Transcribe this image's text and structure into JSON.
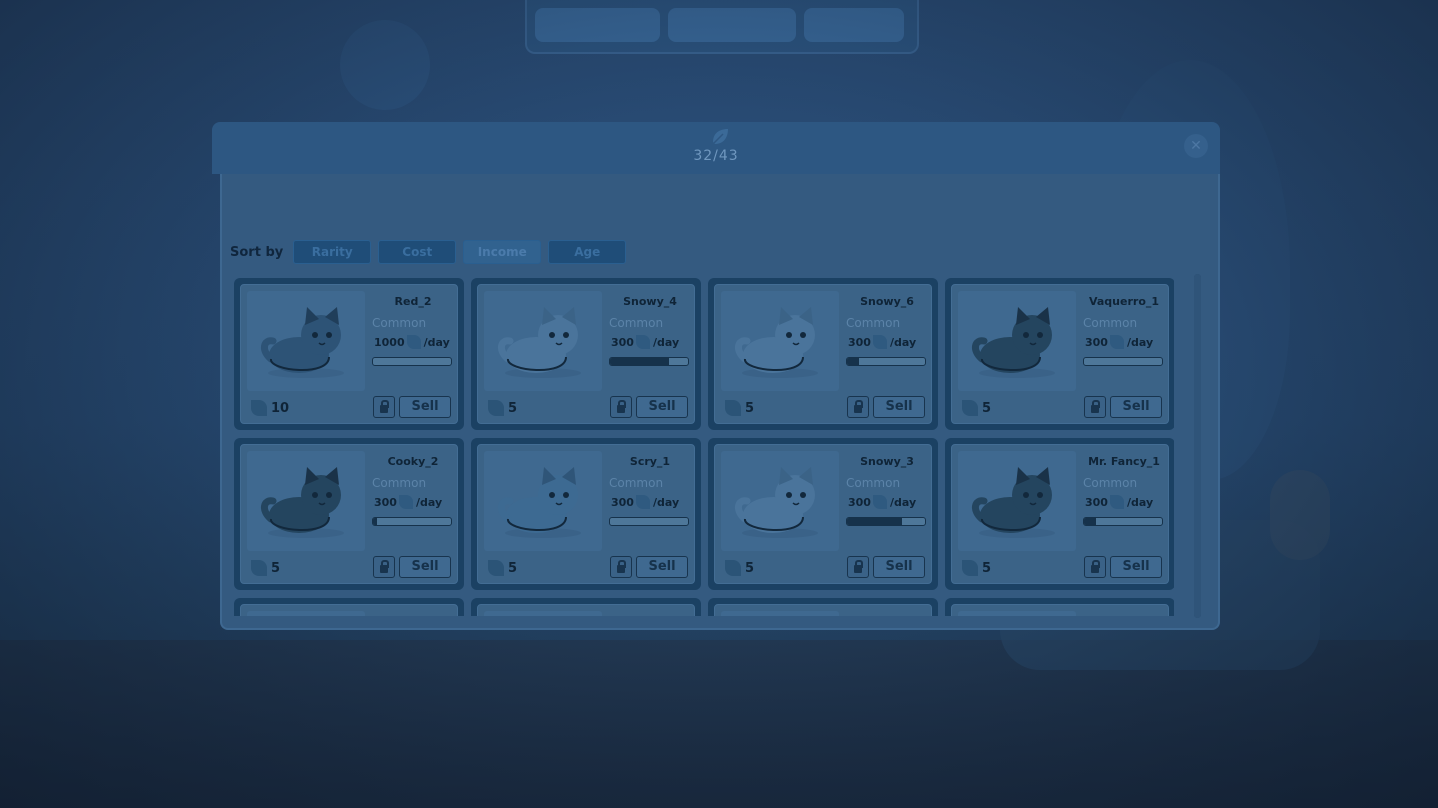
{
  "header": {
    "count": "32/43",
    "icon": "leaf-icon"
  },
  "sort": {
    "label": "Sort by",
    "options": [
      {
        "label": "Rarity",
        "active": false
      },
      {
        "label": "Cost",
        "active": false
      },
      {
        "label": "Income",
        "active": true
      },
      {
        "label": "Age",
        "active": false
      }
    ]
  },
  "pets": [
    {
      "name": "Red_2",
      "rarity": "Common",
      "rate": "1000",
      "unit": "/day",
      "cost": "10",
      "progress": 0.0,
      "fur": "red"
    },
    {
      "name": "Snowy_4",
      "rarity": "Common",
      "rate": "300",
      "unit": "/day",
      "cost": "5",
      "progress": 0.75,
      "fur": "white"
    },
    {
      "name": "Snowy_6",
      "rarity": "Common",
      "rate": "300",
      "unit": "/day",
      "cost": "5",
      "progress": 0.15,
      "fur": "white"
    },
    {
      "name": "Vaquerro_1",
      "rarity": "Common",
      "rate": "300",
      "unit": "/day",
      "cost": "5",
      "progress": 0.0,
      "fur": "dark"
    },
    {
      "name": "Cooky_2",
      "rarity": "Common",
      "rate": "300",
      "unit": "/day",
      "cost": "5",
      "progress": 0.05,
      "fur": "dark"
    },
    {
      "name": "Scry_1",
      "rarity": "Common",
      "rate": "300",
      "unit": "/day",
      "cost": "5",
      "progress": 0.0,
      "fur": "blue"
    },
    {
      "name": "Snowy_3",
      "rarity": "Common",
      "rate": "300",
      "unit": "/day",
      "cost": "5",
      "progress": 0.7,
      "fur": "white"
    },
    {
      "name": "Mr. Fancy_1",
      "rarity": "Common",
      "rate": "300",
      "unit": "/day",
      "cost": "5",
      "progress": 0.15,
      "fur": "dark"
    },
    {
      "name": "",
      "rarity": "",
      "rate": "",
      "unit": "",
      "cost": "",
      "progress": 0.0,
      "fur": "white"
    },
    {
      "name": "",
      "rarity": "",
      "rate": "",
      "unit": "",
      "cost": "",
      "progress": 0.0,
      "fur": "white"
    },
    {
      "name": "",
      "rarity": "",
      "rate": "",
      "unit": "",
      "cost": "",
      "progress": 0.0,
      "fur": "white"
    },
    {
      "name": "",
      "rarity": "",
      "rate": "",
      "unit": "",
      "cost": "",
      "progress": 0.0,
      "fur": "white"
    }
  ],
  "card_actions": {
    "sell_label": "Sell",
    "lock_icon": "lock-icon",
    "currency_icon": "leaf-icon"
  },
  "colors": {
    "accent": "#2d5782",
    "card": "#3b6387",
    "text": "#0f2437"
  }
}
